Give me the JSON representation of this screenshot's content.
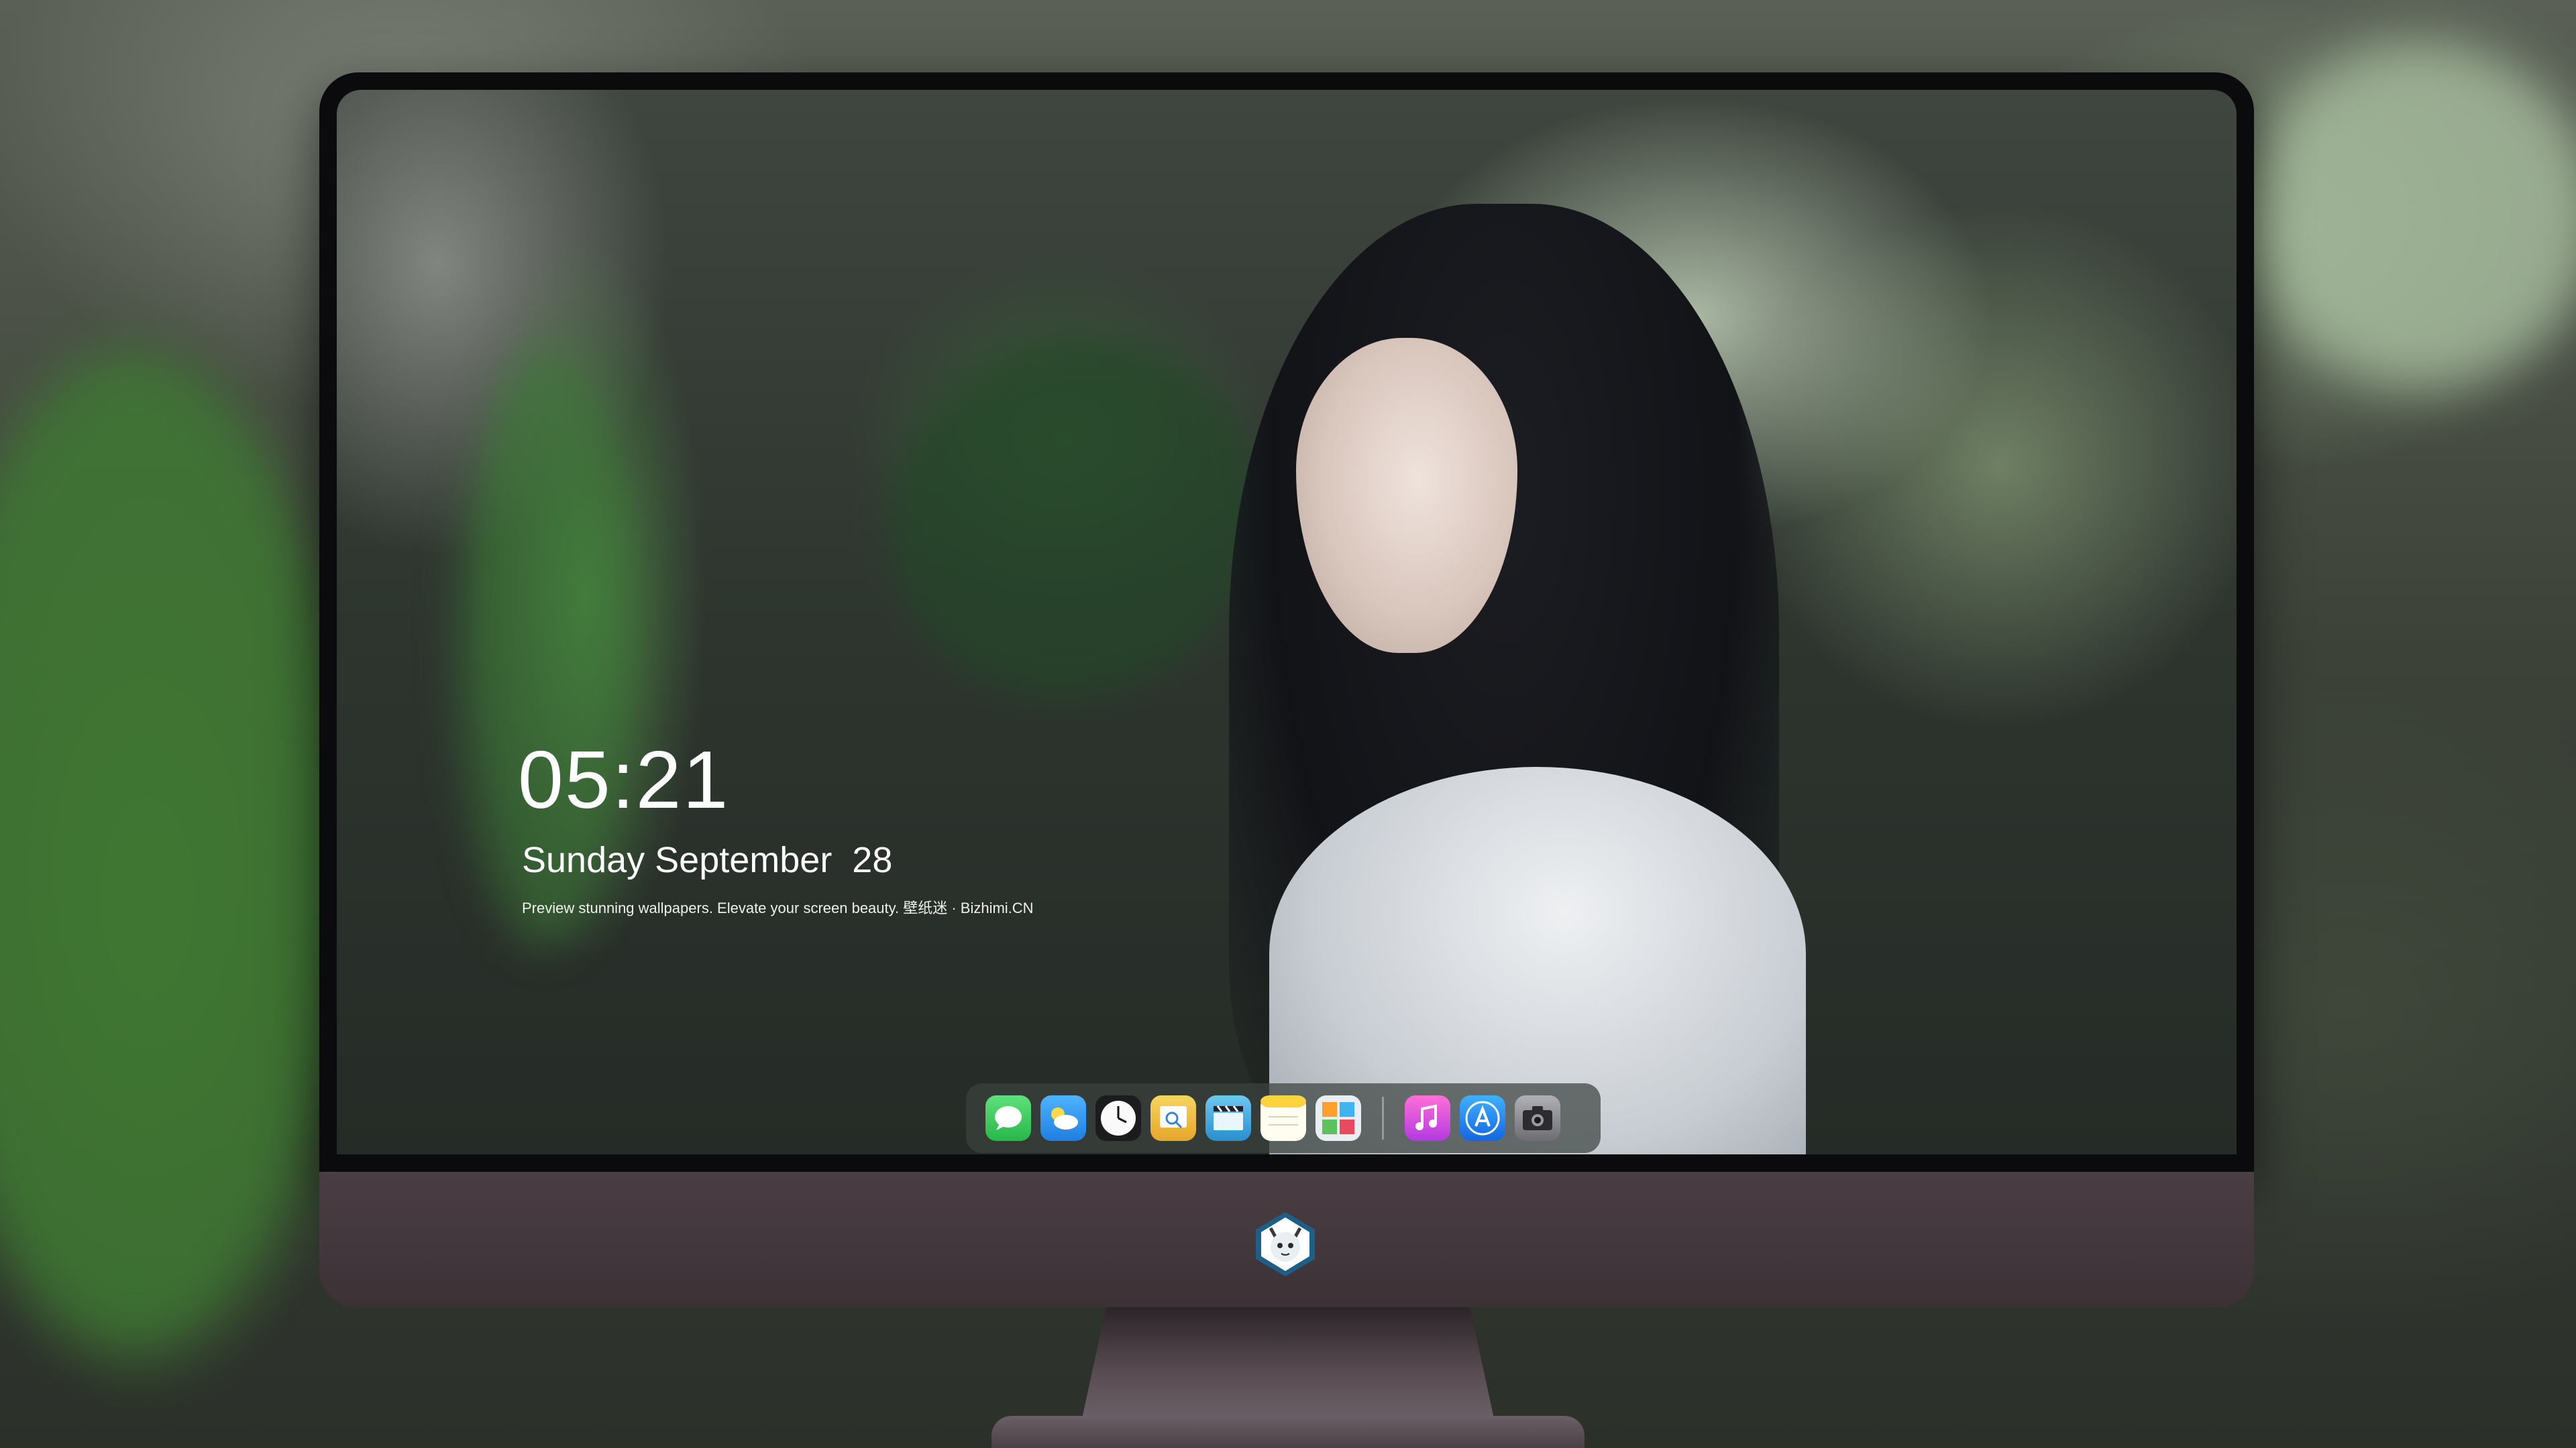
{
  "lockscreen": {
    "time": "05:21",
    "date": "Sunday September  28",
    "tagline": "Preview stunning wallpapers. Elevate your screen beauty. 壁纸迷 · Bizhimi.CN"
  },
  "dock": {
    "apps": [
      {
        "name": "messages-icon",
        "color": "#34c759"
      },
      {
        "name": "weather-icon",
        "color": "#2f9bf0"
      },
      {
        "name": "clock-icon",
        "color": "#f5f5f5"
      },
      {
        "name": "preview-icon",
        "color": "#f0c23a"
      },
      {
        "name": "video-editor-icon",
        "color": "#3aa8e0"
      },
      {
        "name": "notes-icon",
        "color": "#ffd84a"
      },
      {
        "name": "photo-booth-icon",
        "color": "#5cb85c"
      },
      {
        "name": "music-icon",
        "color": "#e64fd1"
      },
      {
        "name": "app-store-icon",
        "color": "#1f8ff5"
      },
      {
        "name": "camera-icon",
        "color": "#8e8e93"
      }
    ]
  },
  "monitor": {
    "bezel_color": "#0b0b0d",
    "chin_color": "#4a3e43",
    "logo": "fox-mascot-logo"
  }
}
